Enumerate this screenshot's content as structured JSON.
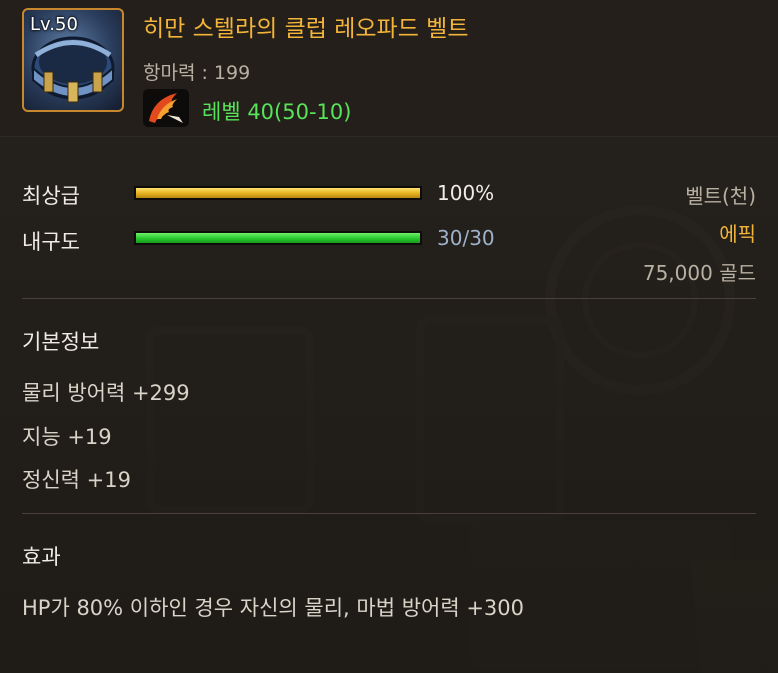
{
  "item": {
    "level_badge": "Lv.50",
    "name": "히만 스텔라의 클럽 레오파드 벨트",
    "resist_text": "항마력 : 199",
    "level_req": "레벨 40(50-10)",
    "icon": "belt-icon",
    "class_icon": "phoenix-wing-icon"
  },
  "stats": {
    "grade": {
      "label": "최상급",
      "value": "100%",
      "fraction": 1.0
    },
    "durability": {
      "label": "내구도",
      "value": "30/30",
      "fraction": 1.0
    }
  },
  "info": {
    "type": "벨트(천)",
    "rarity": "에픽",
    "price": "75,000 골드"
  },
  "basic": {
    "title": "기본정보",
    "lines": [
      "물리 방어력 +299",
      "지능 +19",
      "정신력 +19"
    ]
  },
  "effect": {
    "title": "효과",
    "text": "HP가 80% 이하인 경우 자신의 물리, 마법 방어력 +300"
  },
  "colors": {
    "item_name": "#f2b43a",
    "rarity_epic": "#f2b43a",
    "level_req": "#57e35a",
    "durability_value": "#9fb1c9",
    "grade_bar": "#e3b11e",
    "durability_bar": "#29c62c"
  }
}
